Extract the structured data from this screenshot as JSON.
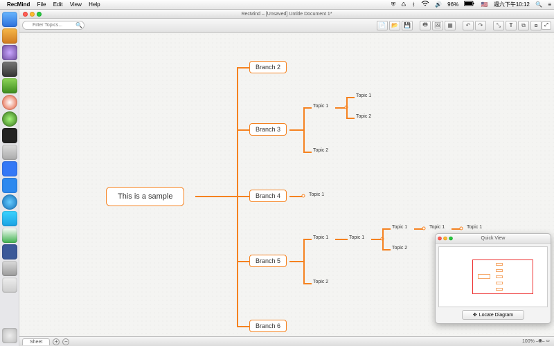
{
  "menubar": {
    "app": "RecMind",
    "items": [
      "File",
      "Edit",
      "View",
      "Help"
    ],
    "battery": "96%",
    "flag": "🇺🇸",
    "clock": "週六下午10:12"
  },
  "window": {
    "title": "RecMind – [Unsaved] Untitle Document 1*"
  },
  "toolbar": {
    "filter_placeholder": "Filter Topics..."
  },
  "mindmap": {
    "root": "This is a sample",
    "branches": {
      "b2": "Branch 2",
      "b3": "Branch 3",
      "b4": "Branch 4",
      "b5": "Branch 5",
      "b6": "Branch 6"
    },
    "topics": {
      "t1": "Topic 1",
      "t2": "Topic 2"
    }
  },
  "quickview": {
    "title": "Quick View",
    "locate": "Locate Diagram"
  },
  "footer": {
    "sheet": "Sheet",
    "zoom": "100%"
  },
  "colors": {
    "accent": "#f58220"
  },
  "dock_icons": [
    "#2b6fdb",
    "#1f9ed8",
    "#6b4a99",
    "#555",
    "#3a3a3a",
    "#57a639",
    "#e34c26",
    "#4db33d",
    "#222",
    "#ccc",
    "#3478f6",
    "#2d89ef",
    "#0f6ab4",
    "#1ba1e2",
    "#3b5998",
    "#888",
    "#aaa"
  ]
}
